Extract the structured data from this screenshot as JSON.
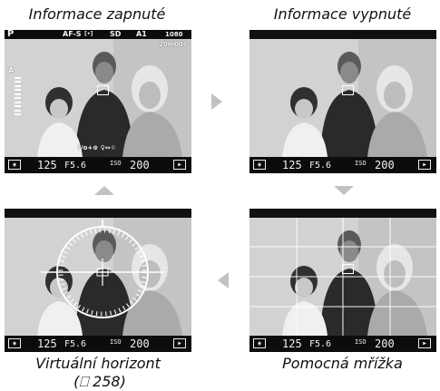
{
  "captions": {
    "top_left": "Informace zapnuté",
    "top_right": "Informace vypnuté",
    "bottom_left_line1": "Virtuální horizont",
    "bottom_left_line2": "(⎕ 258)",
    "bottom_right": "Pomocná mřížka"
  },
  "top_indicators": {
    "mode": "P",
    "focus": "AF-S",
    "focus_area": "[•]",
    "card": "SD",
    "white_balance": "A1",
    "frame_size": "1080",
    "remaining_time": "20m00s",
    "audio": "A"
  },
  "bottom_indicators": {
    "metering_icon": "matrix-metering-icon",
    "shutter": "125",
    "aperture": "F5.6",
    "iso_label": "ISO",
    "iso": "200",
    "movie_icon": "movie-icon"
  },
  "overlay_icons": {
    "bottom_row": "?/o+⊕ ♀↔☼"
  },
  "colors": {
    "screen_bg": "#101010",
    "arrow": "#c2c2c2",
    "text": "#f2f2f2"
  }
}
